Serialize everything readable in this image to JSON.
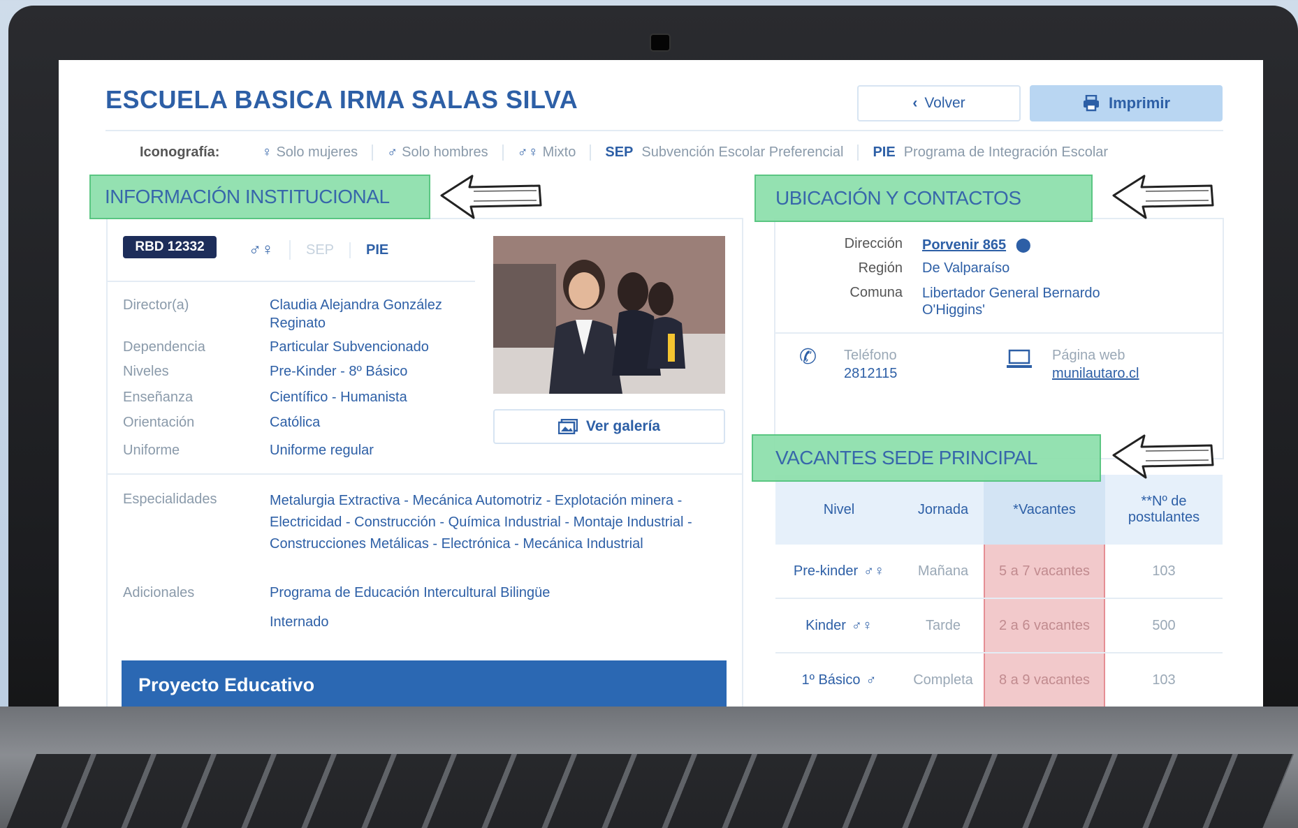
{
  "school": {
    "title": "ESCUELA BASICA IRMA SALAS SILVA",
    "back_label": "Volver",
    "print_label": "Imprimir"
  },
  "iconography": {
    "label": "Iconografía:",
    "items": [
      {
        "abbr": "",
        "text": "Solo mujeres"
      },
      {
        "abbr": "",
        "text": "Solo hombres"
      },
      {
        "abbr": "",
        "text": "Mixto"
      },
      {
        "abbr": "SEP",
        "text": "Subvención Escolar Preferencial"
      },
      {
        "abbr": "PIE",
        "text": "Programa de Integración Escolar"
      }
    ]
  },
  "sections": {
    "institucional": "INFORMACIÓN INSTITUCIONAL",
    "ubicacion": "UBICACIÓN Y CONTACTOS",
    "vacantes": "VACANTES SEDE PRINCIPAL"
  },
  "institutional": {
    "rbd": "RBD 12332",
    "badges": {
      "sep": "SEP",
      "pie": "PIE"
    },
    "gallery_label": "Ver galería",
    "fields": {
      "director_k": "Director(a)",
      "director_v": "Claudia Alejandra González Reginato",
      "dependencia_k": "Dependencia",
      "dependencia_v": "Particular Subvencionado",
      "niveles_k": "Niveles",
      "niveles_v": "Pre-Kinder - 8º Básico",
      "ensenanza_k": "Enseñanza",
      "ensenanza_v": "Científico - Humanista",
      "orientacion_k": "Orientación",
      "orientacion_v": "Católica",
      "uniforme_k": "Uniforme",
      "uniforme_v": "Uniforme regular",
      "especialidades_k": "Especialidades",
      "especialidades_v": "Metalurgia Extractiva - Mecánica Automotriz - Explotación minera - Electricidad - Construcción - Química Industrial - Montaje Industrial - Construcciones Metálicas - Electrónica - Mecánica Industrial",
      "adicionales_k": "Adicionales",
      "adicionales_v1": "Programa de Educación Intercultural Bilingüe",
      "adicionales_v2": "Internado"
    },
    "proyecto": "Proyecto Educativo"
  },
  "contact": {
    "direccion_k": "Dirección",
    "direccion_v": "Porvenir 865",
    "region_k": "Región",
    "region_v": "De Valparaíso",
    "comuna_k": "Comuna",
    "comuna_v": "Libertador General Bernardo O'Higgins'",
    "telefono_k": "Teléfono",
    "telefono_v": "2812115",
    "web_k": "Página web",
    "web_v": "munilautaro.cl"
  },
  "vacancies": {
    "headers": [
      "Nivel",
      "Jornada",
      "*Vacantes",
      "**Nº de postulantes"
    ],
    "rows": [
      {
        "nivel": "Pre-kinder",
        "jornada": "Mañana",
        "vacantes": "5 a 7 vacantes",
        "postulantes": "103"
      },
      {
        "nivel": "Kinder",
        "jornada": "Tarde",
        "vacantes": "2 a 6 vacantes",
        "postulantes": "500"
      },
      {
        "nivel": "1º Básico",
        "jornada": "Completa",
        "vacantes": "8 a 9 vacantes",
        "postulantes": "103"
      }
    ]
  },
  "colors": {
    "brand": "#2d5fa6",
    "highlight_green": "#8fe0ad",
    "highlight_red": "#f2c9cb"
  }
}
